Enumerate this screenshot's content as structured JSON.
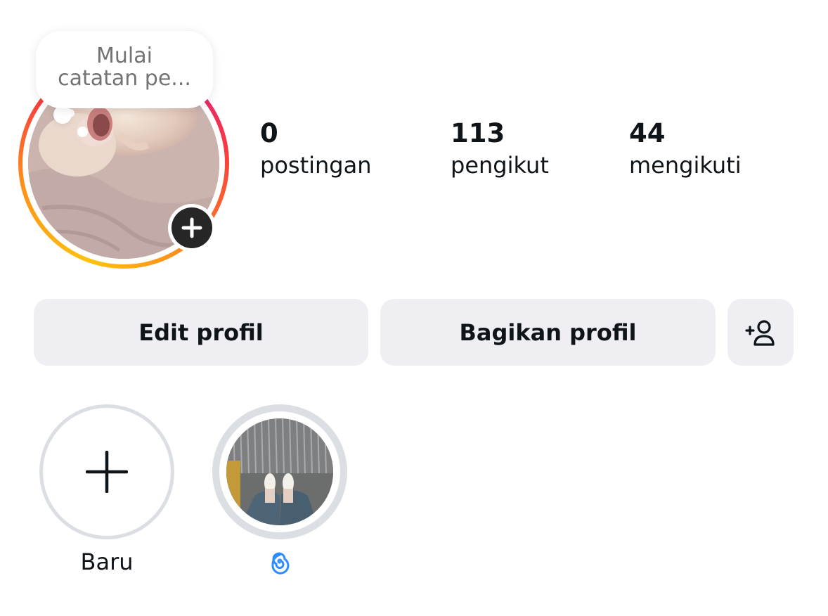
{
  "profile": {
    "note": {
      "line1": "Mulai",
      "line2": "catatan pe..."
    },
    "avatar_icon": "cat-photo",
    "add_story_icon": "plus-icon"
  },
  "stats": {
    "posts": {
      "value": "0",
      "label": "postingan"
    },
    "followers": {
      "value": "113",
      "label": "pengikut"
    },
    "following": {
      "value": "44",
      "label": "mengikuti"
    }
  },
  "actions": {
    "edit_label": "Edit profil",
    "share_label": "Bagikan profil",
    "discover_icon": "add-person-icon"
  },
  "highlights": [
    {
      "label": "Baru",
      "icon": "plus-icon"
    },
    {
      "label": "",
      "icon": "cyclone-emoji"
    }
  ],
  "colors": {
    "button_bg": "#efeff3",
    "text": "#0f1419",
    "muted": "#737373",
    "ring_gradient": [
      "#c913b9",
      "#f9373f",
      "#fe8e1b",
      "#fec30d"
    ],
    "highlight_ring": "#dbdfe4",
    "emoji_blue": "#2d8cff"
  }
}
